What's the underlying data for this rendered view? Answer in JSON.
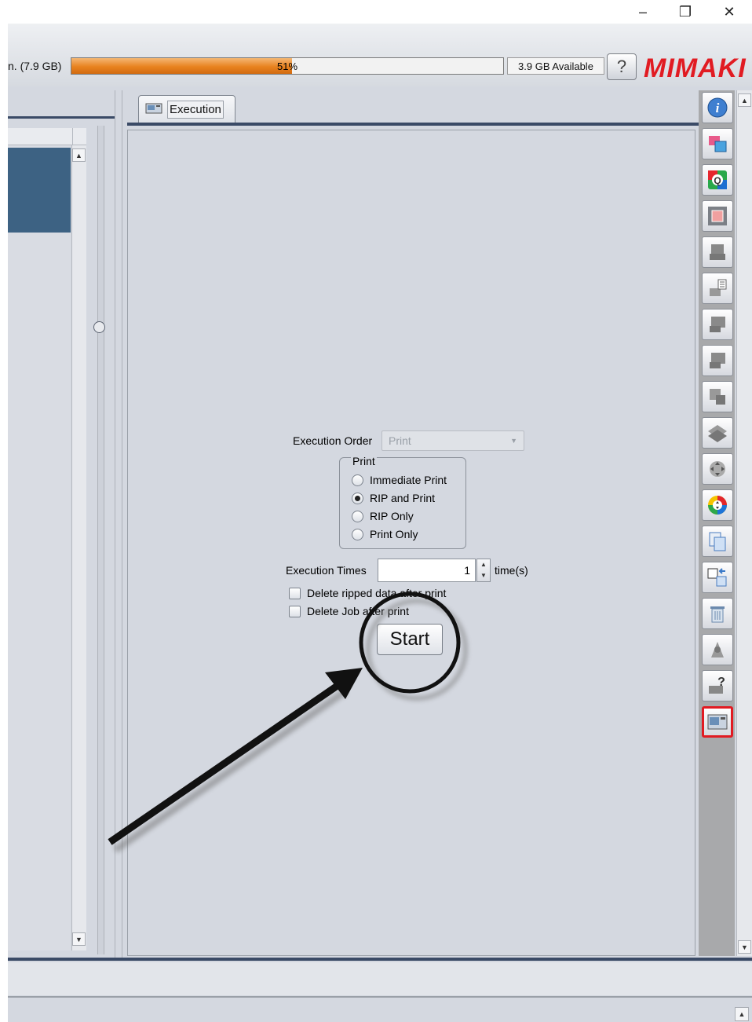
{
  "window": {
    "minimize_glyph": "–",
    "restore_glyph": "❐",
    "close_glyph": "✕"
  },
  "toolbar": {
    "disk_label": "n. (7.9 GB)",
    "disk_usage_percent": 51,
    "disk_usage_text": "51%",
    "disk_available": "3.9 GB Available",
    "help_label": "?",
    "logo_text": "Mimaki",
    "accent_color": "#e8821f",
    "logo_color": "#e11b22"
  },
  "left_panel": {
    "scroll_up": "▲",
    "scroll_down": "▼"
  },
  "main": {
    "tab_label": "Execution",
    "execution_order_label": "Execution Order",
    "execution_order_value": "Print",
    "print_group_title": "Print",
    "print_options": [
      {
        "label": "Immediate Print",
        "selected": false
      },
      {
        "label": "RIP and Print",
        "selected": true
      },
      {
        "label": "RIP Only",
        "selected": false
      },
      {
        "label": "Print Only",
        "selected": false
      }
    ],
    "execution_times_label": "Execution Times",
    "execution_times_value": "1",
    "execution_times_suffix": "time(s)",
    "checkboxes": [
      {
        "label": "Delete ripped data after print",
        "checked": false
      },
      {
        "label": "Delete Job after print",
        "checked": false
      }
    ],
    "start_label": "Start"
  },
  "right_toolbar": {
    "icons": [
      "info-icon",
      "job-properties-icon",
      "quick-preview-icon",
      "crop-icon",
      "layout-icon",
      "nesting-icon",
      "step-repeat-icon",
      "tiling-icon",
      "special-plate-icon",
      "layer-icon",
      "move-icon",
      "color-adjust-icon",
      "copy-job-icon",
      "job-transfer-icon",
      "delete-icon",
      "cut-icon",
      "printer-help-icon",
      "execution-icon"
    ],
    "active_icon": "execution-icon",
    "scroll_up": "▲",
    "scroll_down": "▼"
  }
}
